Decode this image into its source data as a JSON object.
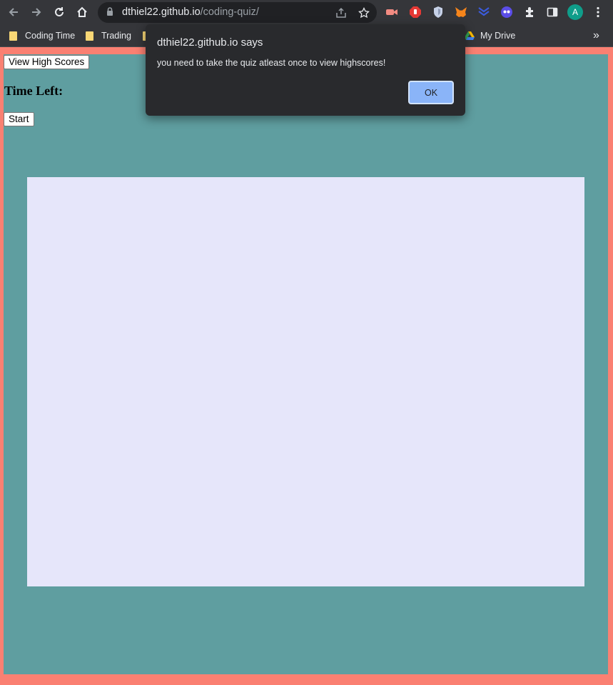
{
  "browser": {
    "url_host": "dthiel22.github.io",
    "url_path": "/coding-quiz/",
    "profile_initial": "A",
    "icons": [
      "back-icon",
      "forward-icon",
      "reload-icon",
      "home-icon",
      "lock-icon",
      "share-icon",
      "bookmark-star-icon",
      "extensions-icon",
      "side-panel-icon",
      "menu-icon"
    ]
  },
  "bookmarks": {
    "items": [
      {
        "label": "Coding Time",
        "icon": "folder-icon"
      },
      {
        "label": "Trading",
        "icon": "folder-icon"
      },
      {
        "label": "My Drive",
        "icon": "google-drive-icon"
      }
    ],
    "overflow": "»"
  },
  "page": {
    "view_high_scores_label": "View High Scores",
    "time_left_label": "Time Left:",
    "start_label": "Start",
    "colors": {
      "border": "#fa8072",
      "background": "#5f9ea0",
      "quiz_area": "#e6e6fa"
    }
  },
  "dialog": {
    "title": "dthiel22.github.io says",
    "message": "you need to take the quiz atleast once to view highscores!",
    "ok_label": "OK",
    "accent": "#8ab4f8"
  }
}
